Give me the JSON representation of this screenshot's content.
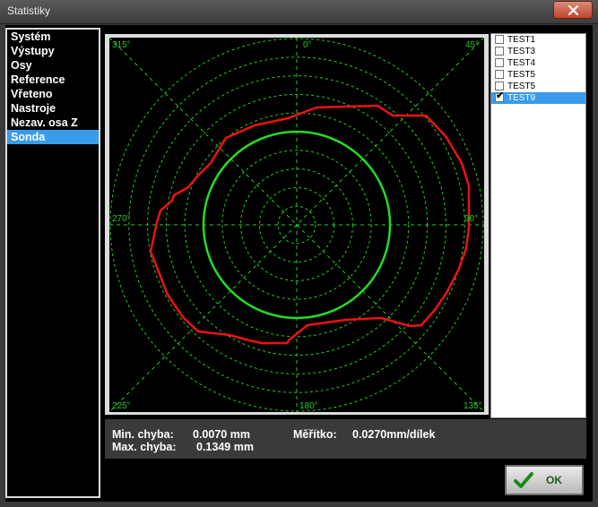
{
  "window": {
    "title": "Statistiky"
  },
  "nav": {
    "items": [
      {
        "label": "Systém",
        "selected": false
      },
      {
        "label": "Výstupy",
        "selected": false
      },
      {
        "label": "Osy",
        "selected": false
      },
      {
        "label": "Reference",
        "selected": false
      },
      {
        "label": "Vřeteno",
        "selected": false
      },
      {
        "label": "Nastroje",
        "selected": false
      },
      {
        "label": "Nezav. osa Z",
        "selected": false
      },
      {
        "label": "Sonda",
        "selected": true
      }
    ]
  },
  "plot": {
    "angle_labels": [
      "315°",
      "0°",
      "45°",
      "270°",
      "90°",
      "225°",
      "180°",
      "135°"
    ],
    "colors": {
      "grid": "#22cc22",
      "reference_circle": "#22dd22",
      "measured": "#ee1111"
    }
  },
  "legend": {
    "items": [
      {
        "label": "TEST1",
        "checked": false,
        "selected": false
      },
      {
        "label": "TEST3",
        "checked": false,
        "selected": false
      },
      {
        "label": "TEST4",
        "checked": false,
        "selected": false
      },
      {
        "label": "TEST5",
        "checked": false,
        "selected": false
      },
      {
        "label": "TEST5",
        "checked": false,
        "selected": false
      },
      {
        "label": "TEST9",
        "checked": true,
        "selected": true
      }
    ]
  },
  "stats": {
    "min_label": "Min. chyba:",
    "min_value": "0.0070 mm",
    "max_label": "Max. chyba:",
    "max_value": "0.1349 mm",
    "scale_label": "Měřítko:",
    "scale_value": "0.0270mm/dílek"
  },
  "buttons": {
    "ok": "OK"
  }
}
